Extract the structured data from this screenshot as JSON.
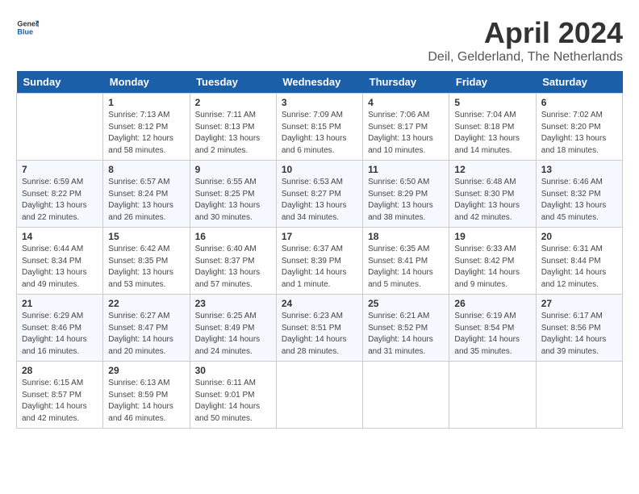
{
  "header": {
    "logo_general": "General",
    "logo_blue": "Blue",
    "title": "April 2024",
    "location": "Deil, Gelderland, The Netherlands"
  },
  "days_of_week": [
    "Sunday",
    "Monday",
    "Tuesday",
    "Wednesday",
    "Thursday",
    "Friday",
    "Saturday"
  ],
  "weeks": [
    [
      {
        "day": "",
        "info": ""
      },
      {
        "day": "1",
        "info": "Sunrise: 7:13 AM\nSunset: 8:12 PM\nDaylight: 12 hours\nand 58 minutes."
      },
      {
        "day": "2",
        "info": "Sunrise: 7:11 AM\nSunset: 8:13 PM\nDaylight: 13 hours\nand 2 minutes."
      },
      {
        "day": "3",
        "info": "Sunrise: 7:09 AM\nSunset: 8:15 PM\nDaylight: 13 hours\nand 6 minutes."
      },
      {
        "day": "4",
        "info": "Sunrise: 7:06 AM\nSunset: 8:17 PM\nDaylight: 13 hours\nand 10 minutes."
      },
      {
        "day": "5",
        "info": "Sunrise: 7:04 AM\nSunset: 8:18 PM\nDaylight: 13 hours\nand 14 minutes."
      },
      {
        "day": "6",
        "info": "Sunrise: 7:02 AM\nSunset: 8:20 PM\nDaylight: 13 hours\nand 18 minutes."
      }
    ],
    [
      {
        "day": "7",
        "info": "Sunrise: 6:59 AM\nSunset: 8:22 PM\nDaylight: 13 hours\nand 22 minutes."
      },
      {
        "day": "8",
        "info": "Sunrise: 6:57 AM\nSunset: 8:24 PM\nDaylight: 13 hours\nand 26 minutes."
      },
      {
        "day": "9",
        "info": "Sunrise: 6:55 AM\nSunset: 8:25 PM\nDaylight: 13 hours\nand 30 minutes."
      },
      {
        "day": "10",
        "info": "Sunrise: 6:53 AM\nSunset: 8:27 PM\nDaylight: 13 hours\nand 34 minutes."
      },
      {
        "day": "11",
        "info": "Sunrise: 6:50 AM\nSunset: 8:29 PM\nDaylight: 13 hours\nand 38 minutes."
      },
      {
        "day": "12",
        "info": "Sunrise: 6:48 AM\nSunset: 8:30 PM\nDaylight: 13 hours\nand 42 minutes."
      },
      {
        "day": "13",
        "info": "Sunrise: 6:46 AM\nSunset: 8:32 PM\nDaylight: 13 hours\nand 45 minutes."
      }
    ],
    [
      {
        "day": "14",
        "info": "Sunrise: 6:44 AM\nSunset: 8:34 PM\nDaylight: 13 hours\nand 49 minutes."
      },
      {
        "day": "15",
        "info": "Sunrise: 6:42 AM\nSunset: 8:35 PM\nDaylight: 13 hours\nand 53 minutes."
      },
      {
        "day": "16",
        "info": "Sunrise: 6:40 AM\nSunset: 8:37 PM\nDaylight: 13 hours\nand 57 minutes."
      },
      {
        "day": "17",
        "info": "Sunrise: 6:37 AM\nSunset: 8:39 PM\nDaylight: 14 hours\nand 1 minute."
      },
      {
        "day": "18",
        "info": "Sunrise: 6:35 AM\nSunset: 8:41 PM\nDaylight: 14 hours\nand 5 minutes."
      },
      {
        "day": "19",
        "info": "Sunrise: 6:33 AM\nSunset: 8:42 PM\nDaylight: 14 hours\nand 9 minutes."
      },
      {
        "day": "20",
        "info": "Sunrise: 6:31 AM\nSunset: 8:44 PM\nDaylight: 14 hours\nand 12 minutes."
      }
    ],
    [
      {
        "day": "21",
        "info": "Sunrise: 6:29 AM\nSunset: 8:46 PM\nDaylight: 14 hours\nand 16 minutes."
      },
      {
        "day": "22",
        "info": "Sunrise: 6:27 AM\nSunset: 8:47 PM\nDaylight: 14 hours\nand 20 minutes."
      },
      {
        "day": "23",
        "info": "Sunrise: 6:25 AM\nSunset: 8:49 PM\nDaylight: 14 hours\nand 24 minutes."
      },
      {
        "day": "24",
        "info": "Sunrise: 6:23 AM\nSunset: 8:51 PM\nDaylight: 14 hours\nand 28 minutes."
      },
      {
        "day": "25",
        "info": "Sunrise: 6:21 AM\nSunset: 8:52 PM\nDaylight: 14 hours\nand 31 minutes."
      },
      {
        "day": "26",
        "info": "Sunrise: 6:19 AM\nSunset: 8:54 PM\nDaylight: 14 hours\nand 35 minutes."
      },
      {
        "day": "27",
        "info": "Sunrise: 6:17 AM\nSunset: 8:56 PM\nDaylight: 14 hours\nand 39 minutes."
      }
    ],
    [
      {
        "day": "28",
        "info": "Sunrise: 6:15 AM\nSunset: 8:57 PM\nDaylight: 14 hours\nand 42 minutes."
      },
      {
        "day": "29",
        "info": "Sunrise: 6:13 AM\nSunset: 8:59 PM\nDaylight: 14 hours\nand 46 minutes."
      },
      {
        "day": "30",
        "info": "Sunrise: 6:11 AM\nSunset: 9:01 PM\nDaylight: 14 hours\nand 50 minutes."
      },
      {
        "day": "",
        "info": ""
      },
      {
        "day": "",
        "info": ""
      },
      {
        "day": "",
        "info": ""
      },
      {
        "day": "",
        "info": ""
      }
    ]
  ]
}
